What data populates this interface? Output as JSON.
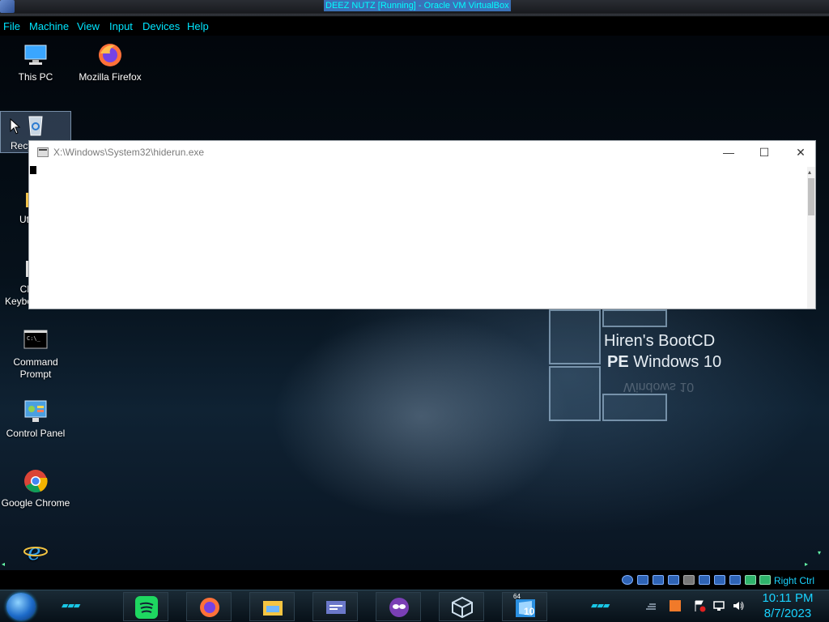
{
  "host": {
    "window_title": "DEEZ NUTZ [Running] - Oracle VM VirtualBox",
    "menu": [
      "File",
      "Machine",
      "View",
      "Input",
      "Devices",
      "Help"
    ],
    "host_key_label": "Right Ctrl"
  },
  "desktop": {
    "icons": [
      {
        "label": "This PC",
        "icon": "this-pc-icon"
      },
      {
        "label": "Mozilla Firefox",
        "icon": "firefox-icon"
      },
      {
        "label": "Recy",
        "icon": "recycle-bin-icon"
      },
      {
        "label": "Ut",
        "icon": "folder-icon"
      },
      {
        "label": "Ch Keybo",
        "icon": "keyboard-icon"
      },
      {
        "label": "Command Prompt",
        "icon": "command-prompt-icon"
      },
      {
        "label": "Control Panel",
        "icon": "control-panel-icon"
      },
      {
        "label": "Google Chrome",
        "icon": "chrome-icon"
      },
      {
        "label": "",
        "icon": "internet-explorer-icon"
      }
    ],
    "wallpaper_logo": {
      "line1": "Hiren's BootCD",
      "line2_bold": "PE",
      "line2_rest": " Windows 10"
    }
  },
  "console_window": {
    "title": "X:\\Windows\\System32\\hiderun.exe",
    "minimize_glyph": "—",
    "maximize_glyph": "☐",
    "close_glyph": "✕"
  },
  "taskbar": {
    "pinned": [
      {
        "name": "spotify-icon",
        "color": "#1ed760"
      },
      {
        "name": "firefox-icon",
        "color": "#ff7139"
      },
      {
        "name": "file-explorer-icon",
        "color": "#f5c542"
      },
      {
        "name": "window-app-icon",
        "color": "#6b78c9"
      },
      {
        "name": "masked-app-icon",
        "color": "#7a3fb5"
      },
      {
        "name": "virtualbox-cube-icon",
        "color": "#9fb4c7"
      },
      {
        "name": "windows-10-64-icon",
        "color": "#2a8fe0"
      }
    ],
    "windows_badge": "10",
    "windows_badge_small": "64",
    "clock_time": "10:11 PM",
    "clock_date": "8/7/2023"
  },
  "colors": {
    "accent": "#19d3ff",
    "menu_text": "#00e6ff"
  }
}
